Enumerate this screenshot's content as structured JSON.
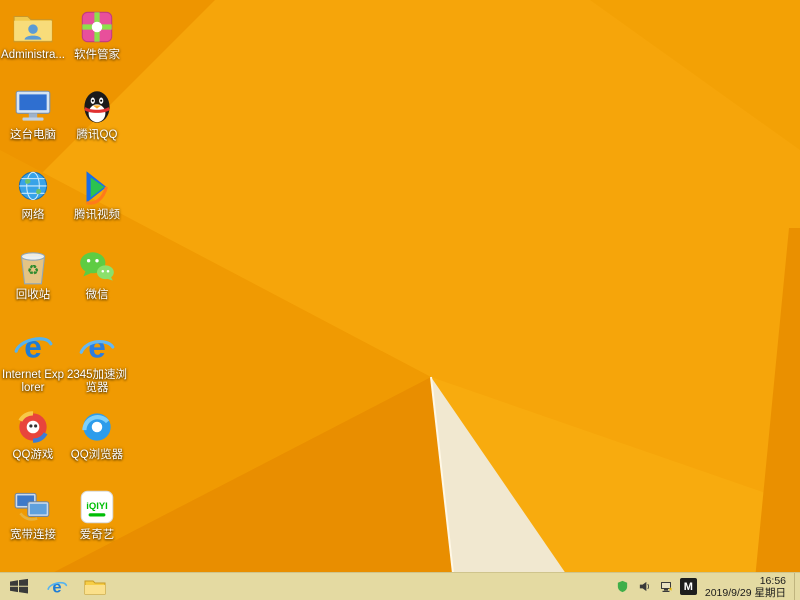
{
  "colors": {
    "wallpaper_base": "#F6A50A",
    "wallpaper_dark_wedge": "#E98E00",
    "wallpaper_cream": "#F1E8D0",
    "taskbar_bg": "#E4DAA2"
  },
  "desktop": {
    "column1": [
      {
        "name": "administrator-files",
        "label": "Administra..."
      },
      {
        "name": "this-pc",
        "label": "这台电脑"
      },
      {
        "name": "network",
        "label": "网络"
      },
      {
        "name": "recycle-bin",
        "label": "回收站"
      },
      {
        "name": "internet-explorer",
        "label": "Internet Explorer"
      },
      {
        "name": "qq-games",
        "label": "QQ游戏"
      },
      {
        "name": "broadband-connection",
        "label": "宽带连接"
      }
    ],
    "column2": [
      {
        "name": "software-manager",
        "label": "软件管家"
      },
      {
        "name": "tencent-qq",
        "label": "腾讯QQ"
      },
      {
        "name": "tencent-video",
        "label": "腾讯视频"
      },
      {
        "name": "wechat",
        "label": "微信"
      },
      {
        "name": "2345-browser",
        "label": "2345加速浏览器"
      },
      {
        "name": "qq-browser",
        "label": "QQ浏览器"
      },
      {
        "name": "iqiyi",
        "label": "爱奇艺"
      }
    ]
  },
  "taskbar": {
    "pinned_icons": [
      "start",
      "internet-explorer",
      "file-explorer"
    ],
    "tray": {
      "icons": [
        "security-shield",
        "volume",
        "network-status"
      ],
      "ime": "M",
      "time": "16:56",
      "date": "2019/9/29 星期日"
    }
  }
}
